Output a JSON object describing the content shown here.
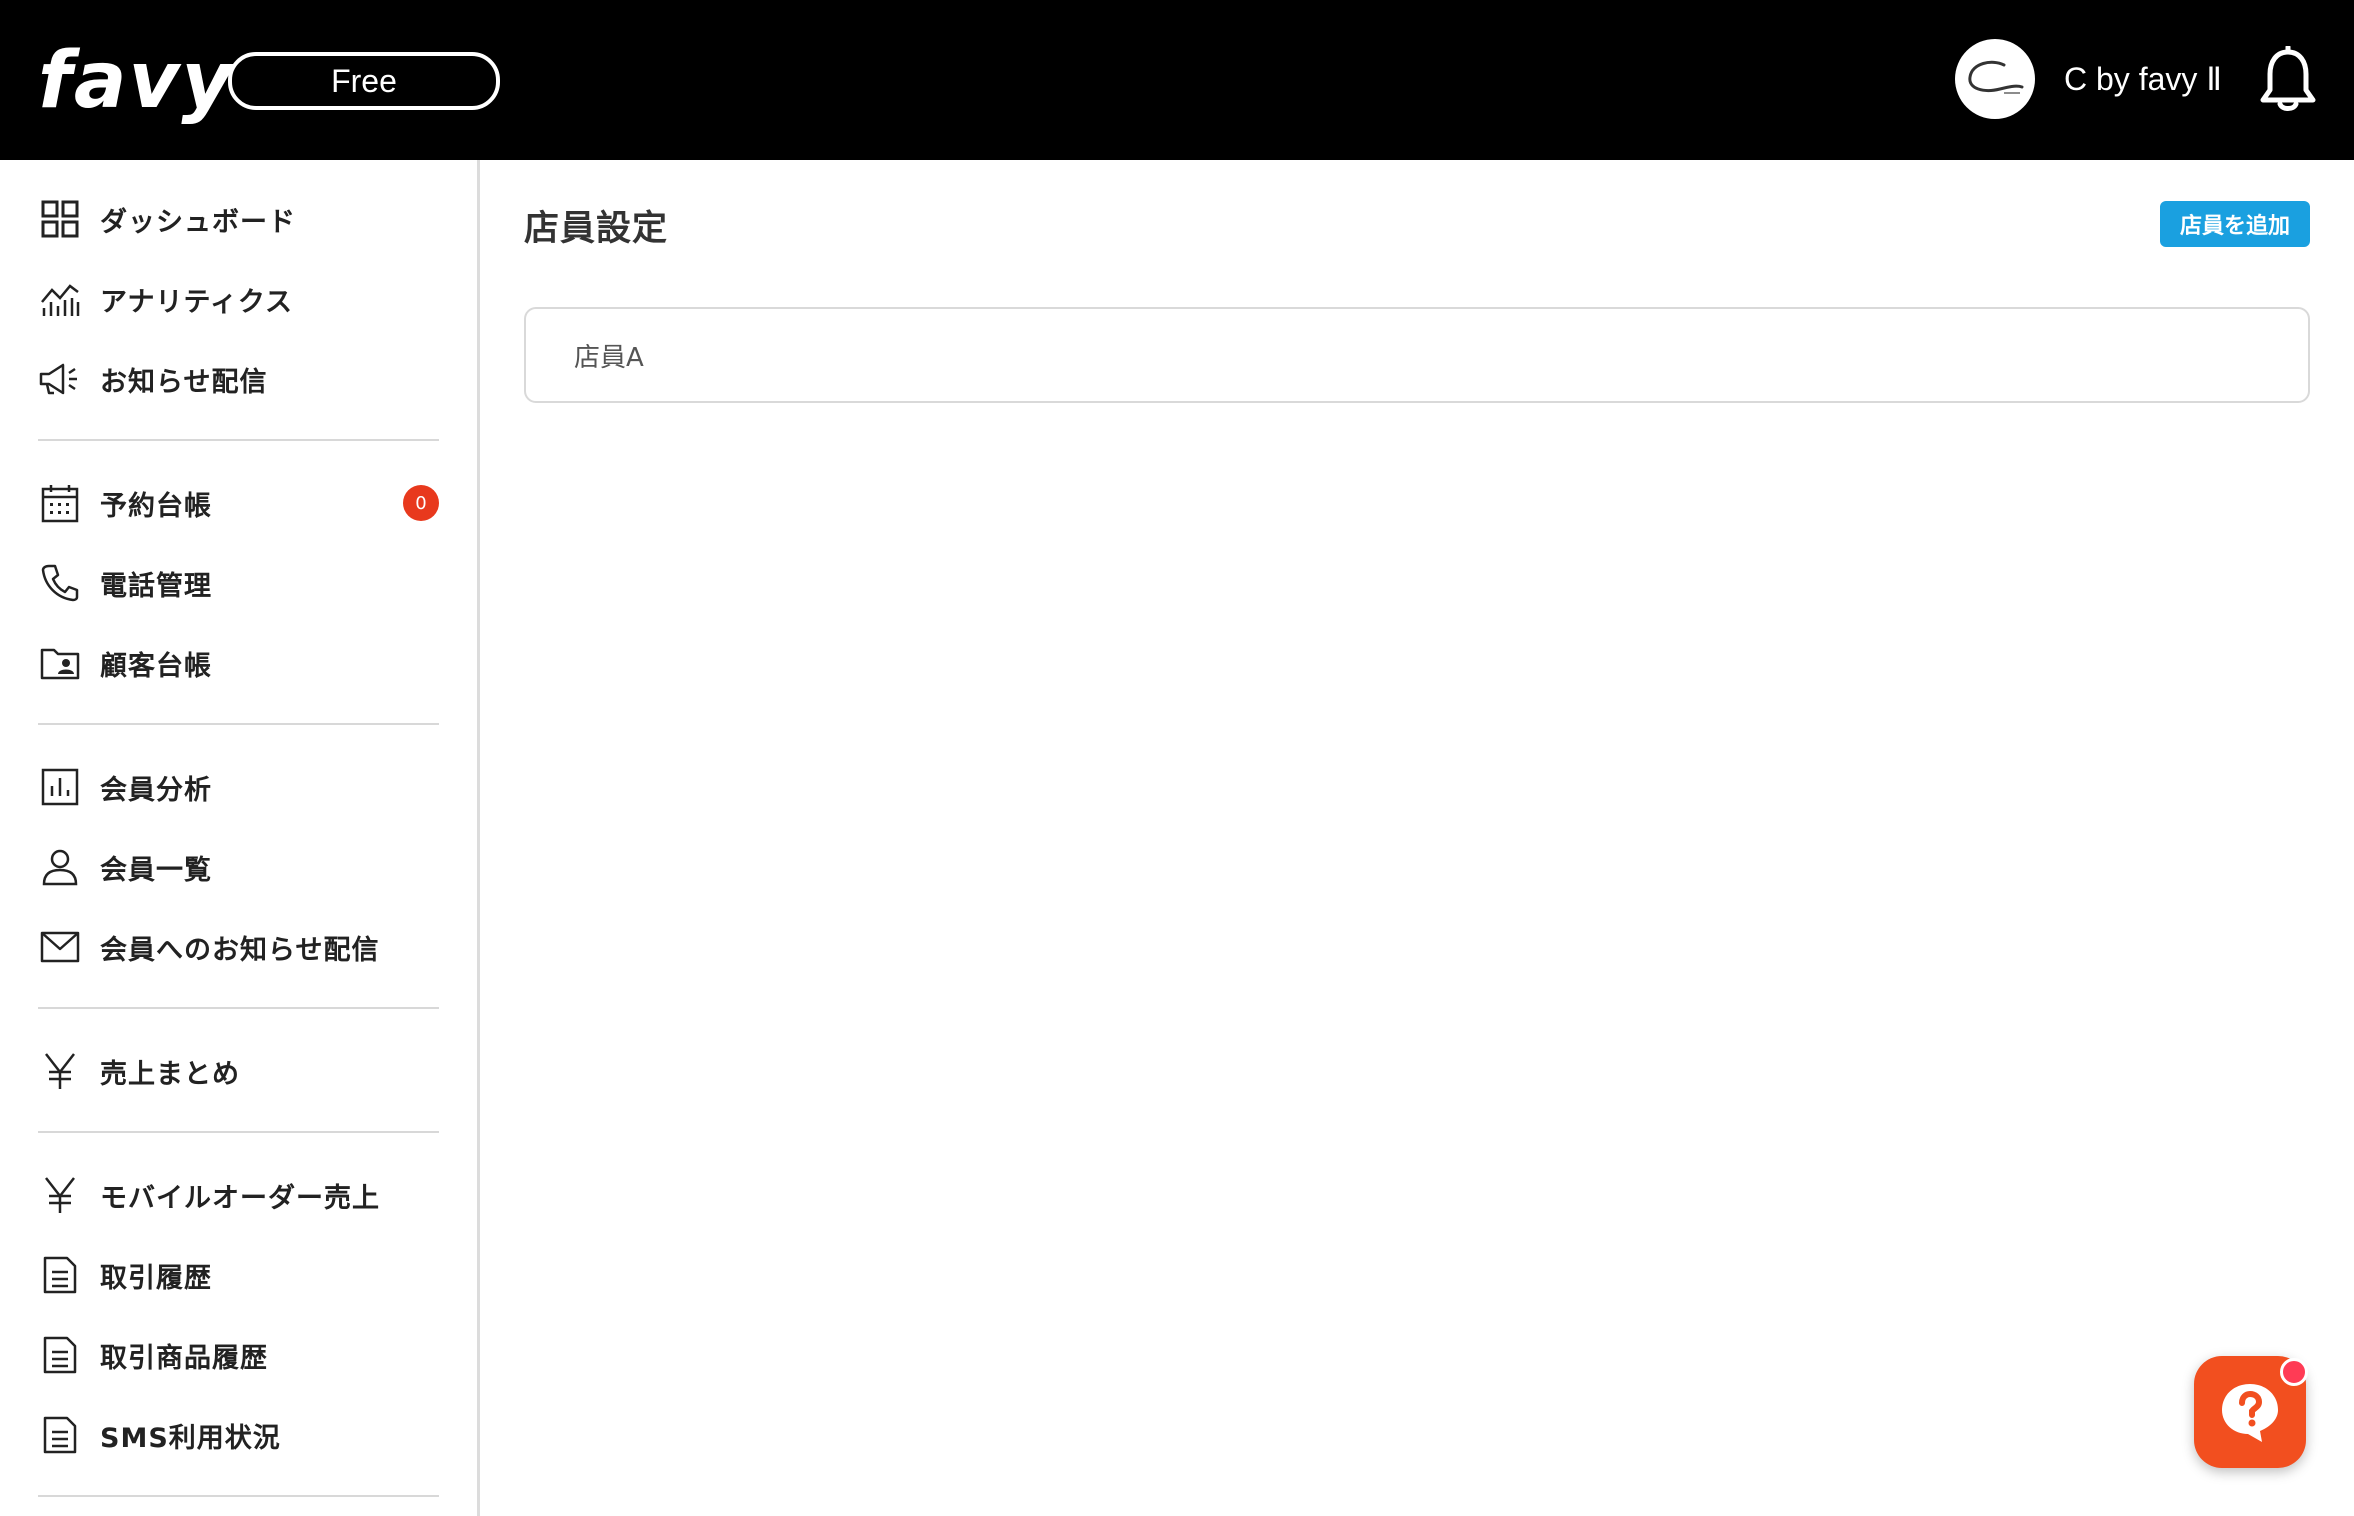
{
  "header": {
    "logo": "favy",
    "plan": "Free",
    "account_name": "C by favy Ⅱ"
  },
  "sidebar": {
    "groups": [
      [
        {
          "label": "ダッシュボード",
          "icon": "dashboard-grid-icon"
        },
        {
          "label": "アナリティクス",
          "icon": "analytics-chart-icon"
        },
        {
          "label": "お知らせ配信",
          "icon": "megaphone-icon"
        }
      ],
      [
        {
          "label": "予約台帳",
          "icon": "calendar-icon",
          "badge": "0"
        },
        {
          "label": "電話管理",
          "icon": "phone-icon"
        },
        {
          "label": "顧客台帳",
          "icon": "customer-folder-icon"
        }
      ],
      [
        {
          "label": "会員分析",
          "icon": "bar-chart-icon"
        },
        {
          "label": "会員一覧",
          "icon": "person-icon"
        },
        {
          "label": "会員へのお知らせ配信",
          "icon": "mail-icon"
        }
      ],
      [
        {
          "label": "売上まとめ",
          "icon": "yen-icon"
        }
      ],
      [
        {
          "label": "モバイルオーダー売上",
          "icon": "yen-icon"
        },
        {
          "label": "取引履歴",
          "icon": "document-icon"
        },
        {
          "label": "取引商品履歴",
          "icon": "document-icon"
        },
        {
          "label": "SMS利用状況",
          "icon": "document-icon"
        }
      ]
    ]
  },
  "main": {
    "title": "店員設定",
    "add_button": "店員を追加",
    "staff": [
      "店員A"
    ]
  },
  "colors": {
    "header_bg": "#000000",
    "accent": "#1aa0e0",
    "badge": "#e8391d",
    "help_button": "#f24f1f"
  }
}
